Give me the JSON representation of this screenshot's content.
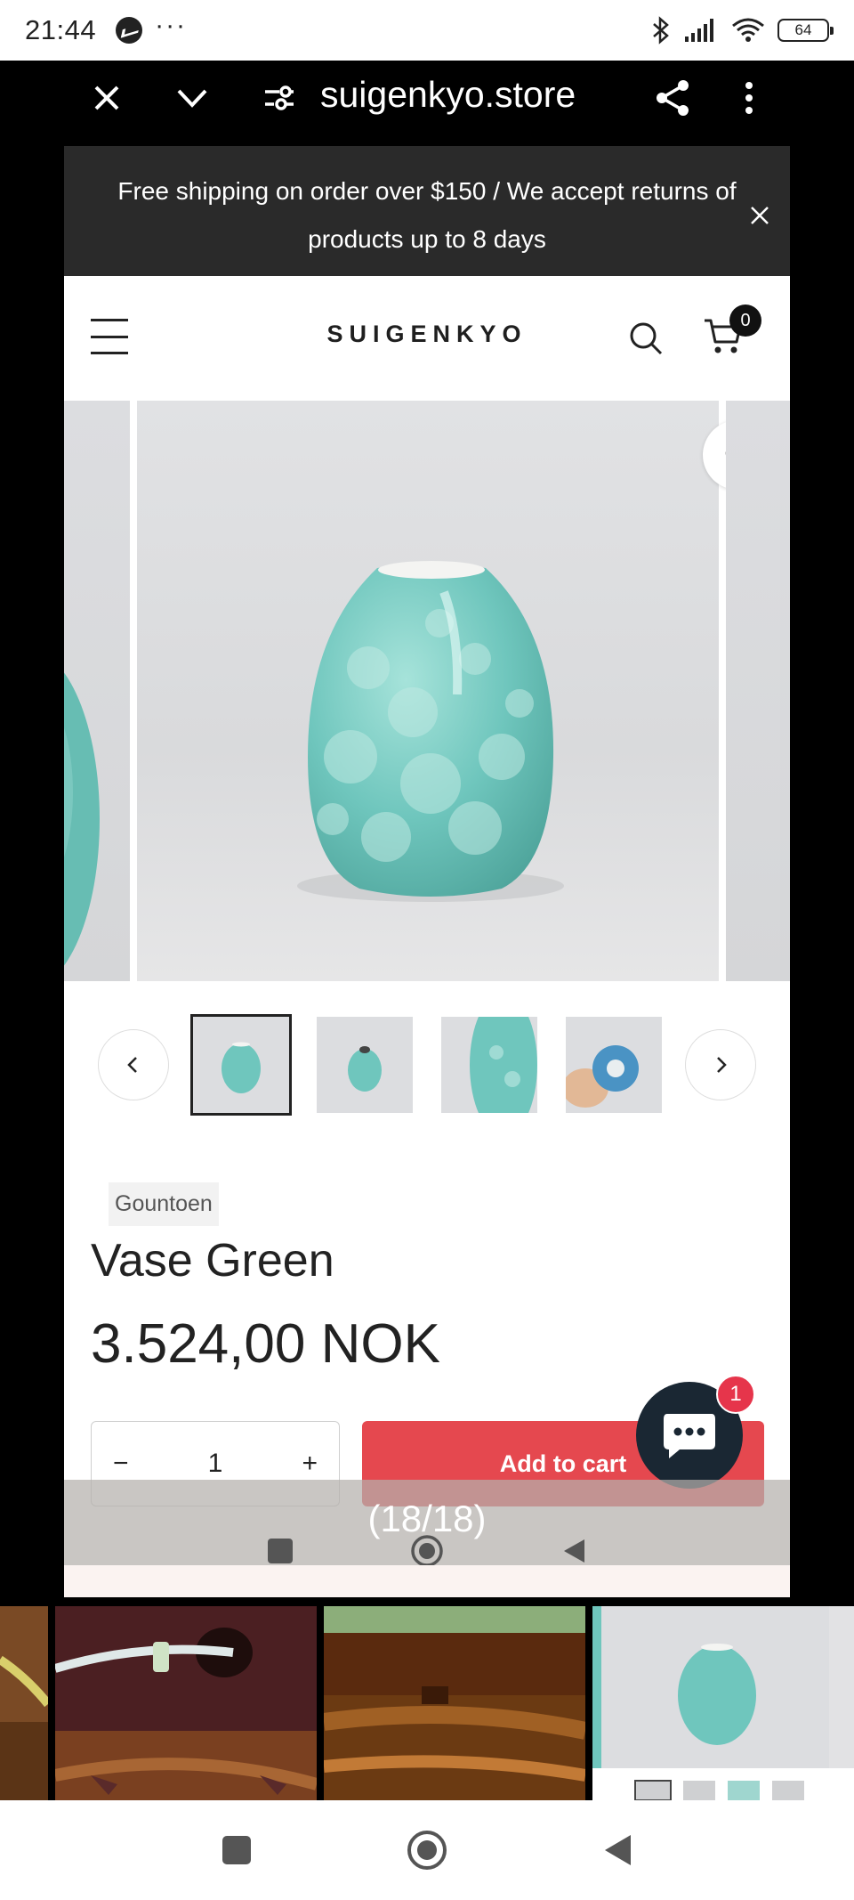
{
  "status_bar": {
    "time": "21:44",
    "more": "···",
    "battery": "64",
    "icons": [
      "messenger-icon",
      "bluetooth-icon",
      "signal-icon",
      "wifi-icon",
      "battery-icon"
    ]
  },
  "browser": {
    "url": "suigenkyo.store",
    "icons": [
      "close-icon",
      "chevron-down-icon",
      "site-settings-icon",
      "share-icon",
      "more-vert-icon"
    ]
  },
  "announcement": {
    "text": "Free shipping on order over $150 / We accept returns of products up to 8 days"
  },
  "header": {
    "logo": "SUIGENKYO",
    "cart_count": "0"
  },
  "product": {
    "vendor": "Gountoen",
    "title": "Vase Green",
    "price": "3.524,00 NOK",
    "quantity": "1",
    "minus": "−",
    "plus": "+",
    "add_to_cart": "Add to cart"
  },
  "gallery": {
    "thumbnail_count": 4,
    "active_thumbnail": 1
  },
  "chat": {
    "badge": "1"
  },
  "viewer": {
    "counter": "(18/18)"
  },
  "colors": {
    "accent": "#e5484f",
    "vase": "#6fc6bd",
    "announce_bg": "#2a2a2a",
    "chat_bg": "#1a2733"
  }
}
